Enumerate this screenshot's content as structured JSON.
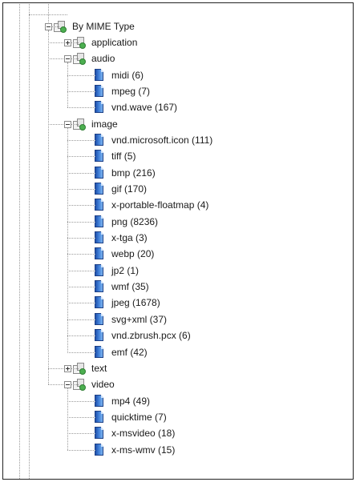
{
  "tree": {
    "root": {
      "label": "By MIME Type",
      "icon": "category-icon",
      "expanded": true
    },
    "categories": [
      {
        "label": "application",
        "icon": "category-icon",
        "expanded": false,
        "children": []
      },
      {
        "label": "audio",
        "icon": "category-icon",
        "expanded": true,
        "children": [
          "midi (6)",
          "mpeg (7)",
          "vnd.wave (167)"
        ]
      },
      {
        "label": "image",
        "icon": "category-icon",
        "expanded": true,
        "children": [
          "vnd.microsoft.icon (111)",
          "tiff (5)",
          "bmp (216)",
          "gif (170)",
          "x-portable-floatmap (4)",
          "png (8236)",
          "x-tga (3)",
          "webp (20)",
          "jp2 (1)",
          "wmf (35)",
          "jpeg (1678)",
          "svg+xml (37)",
          "vnd.zbrush.pcx (6)",
          "emf (42)"
        ]
      },
      {
        "label": "text",
        "icon": "category-icon",
        "expanded": false,
        "children": []
      },
      {
        "label": "video",
        "icon": "category-icon",
        "expanded": true,
        "children": [
          "mp4 (49)",
          "quicktime (7)",
          "x-msvideo (18)",
          "x-ms-wmv (15)"
        ]
      }
    ],
    "file_icon": "file-type-icon",
    "colors": {
      "file_icon": "#2f6fd0",
      "category_badge": "#4caf50",
      "connector": "#9a9a9a"
    }
  }
}
